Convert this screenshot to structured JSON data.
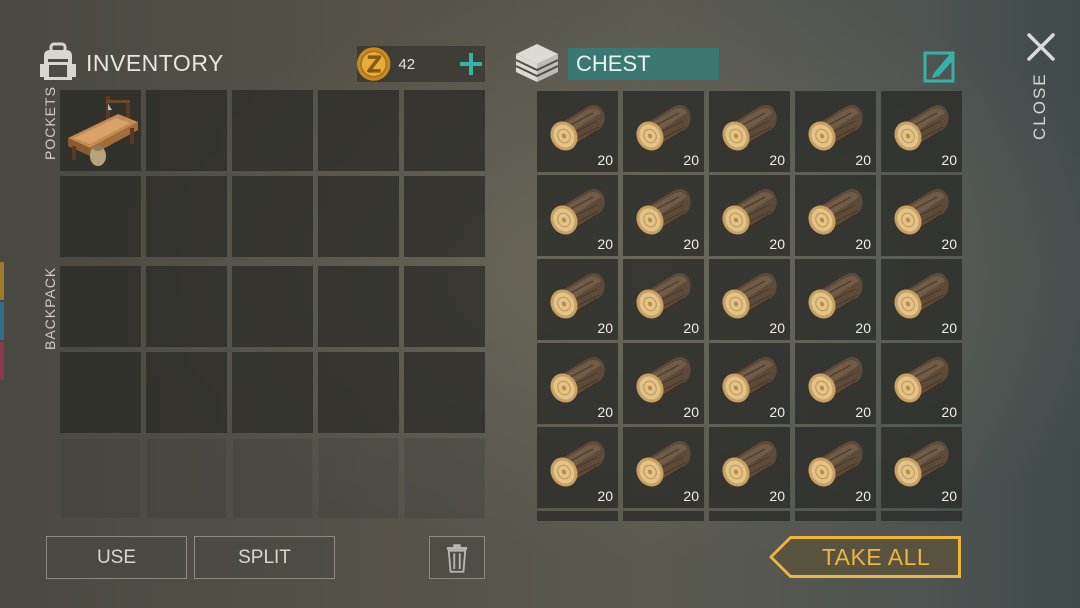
{
  "colors": {
    "accent_teal": "#36b3a6",
    "chest_title_bg": "#3b7773",
    "take_all_gold": "#f0b53a",
    "coin_gold": "#d99a2b"
  },
  "inventory": {
    "title": "INVENTORY",
    "icon": "backpack-icon",
    "coins": {
      "icon": "coin-icon",
      "count": "42",
      "add_icon": "plus-icon"
    },
    "sections": {
      "pockets": "POCKETS",
      "backpack": "BACKPACK"
    },
    "pocket_items": [
      {
        "name": "crafting-bench-icon",
        "quantity": ""
      }
    ]
  },
  "chest": {
    "title": "CHEST",
    "icon": "chest-stack-icon",
    "rename_icon": "edit-icon",
    "item": {
      "name": "log-icon",
      "quantity": "20"
    },
    "rows": 5,
    "cols": 5
  },
  "close": {
    "label": "CLOSE",
    "icon": "close-icon"
  },
  "buttons": {
    "use": "USE",
    "split": "SPLIT",
    "trash_icon": "trash-icon",
    "take_all": "TAKE ALL"
  }
}
